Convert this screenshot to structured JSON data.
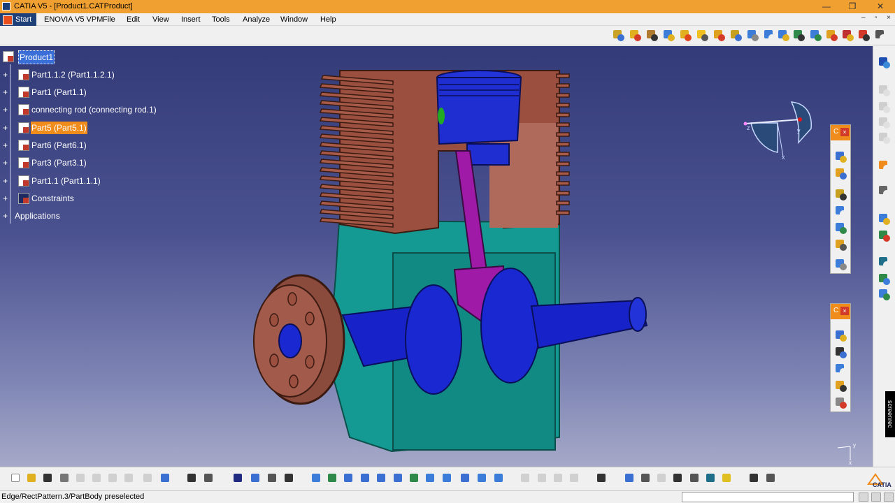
{
  "window": {
    "title": "CATIA V5 - [Product1.CATProduct]",
    "controls": [
      "—",
      "❐",
      "✕"
    ]
  },
  "menubar": {
    "start": "Start",
    "items": [
      "ENOVIA V5 VPM",
      "File",
      "Edit",
      "View",
      "Insert",
      "Tools",
      "Analyze",
      "Window",
      "Help"
    ],
    "mdi_controls": [
      "–",
      "▫",
      "×"
    ]
  },
  "spec_tree": {
    "root": "Product1",
    "nodes": [
      "Part1.1.2 (Part1.1.2.1)",
      "Part1 (Part1.1)",
      "connecting rod (connecting rod.1)",
      "Part5 (Part5.1)",
      "Part6 (Part6.1)",
      "Part3 (Part3.1)",
      "Part1.1 (Part1.1.1)",
      "Constraints",
      "Applications"
    ],
    "selected_node": "Part5 (Part5.1)"
  },
  "compass": {
    "x_label": "x",
    "y_label": "y",
    "z_label": "z"
  },
  "floating_toolbar_head": "C",
  "status": {
    "message": "Edge/RectPattern.3/PartBody preselected"
  },
  "brand": {
    "logo_text": "CATIA"
  },
  "watermark": "screenrec",
  "colors": {
    "title_bar": "#f0a030",
    "selection_orange": "#f08c1c",
    "selection_blue": "#3a6fd8",
    "viewport_top": "#333b78",
    "viewport_bottom": "#a6a9c8"
  }
}
